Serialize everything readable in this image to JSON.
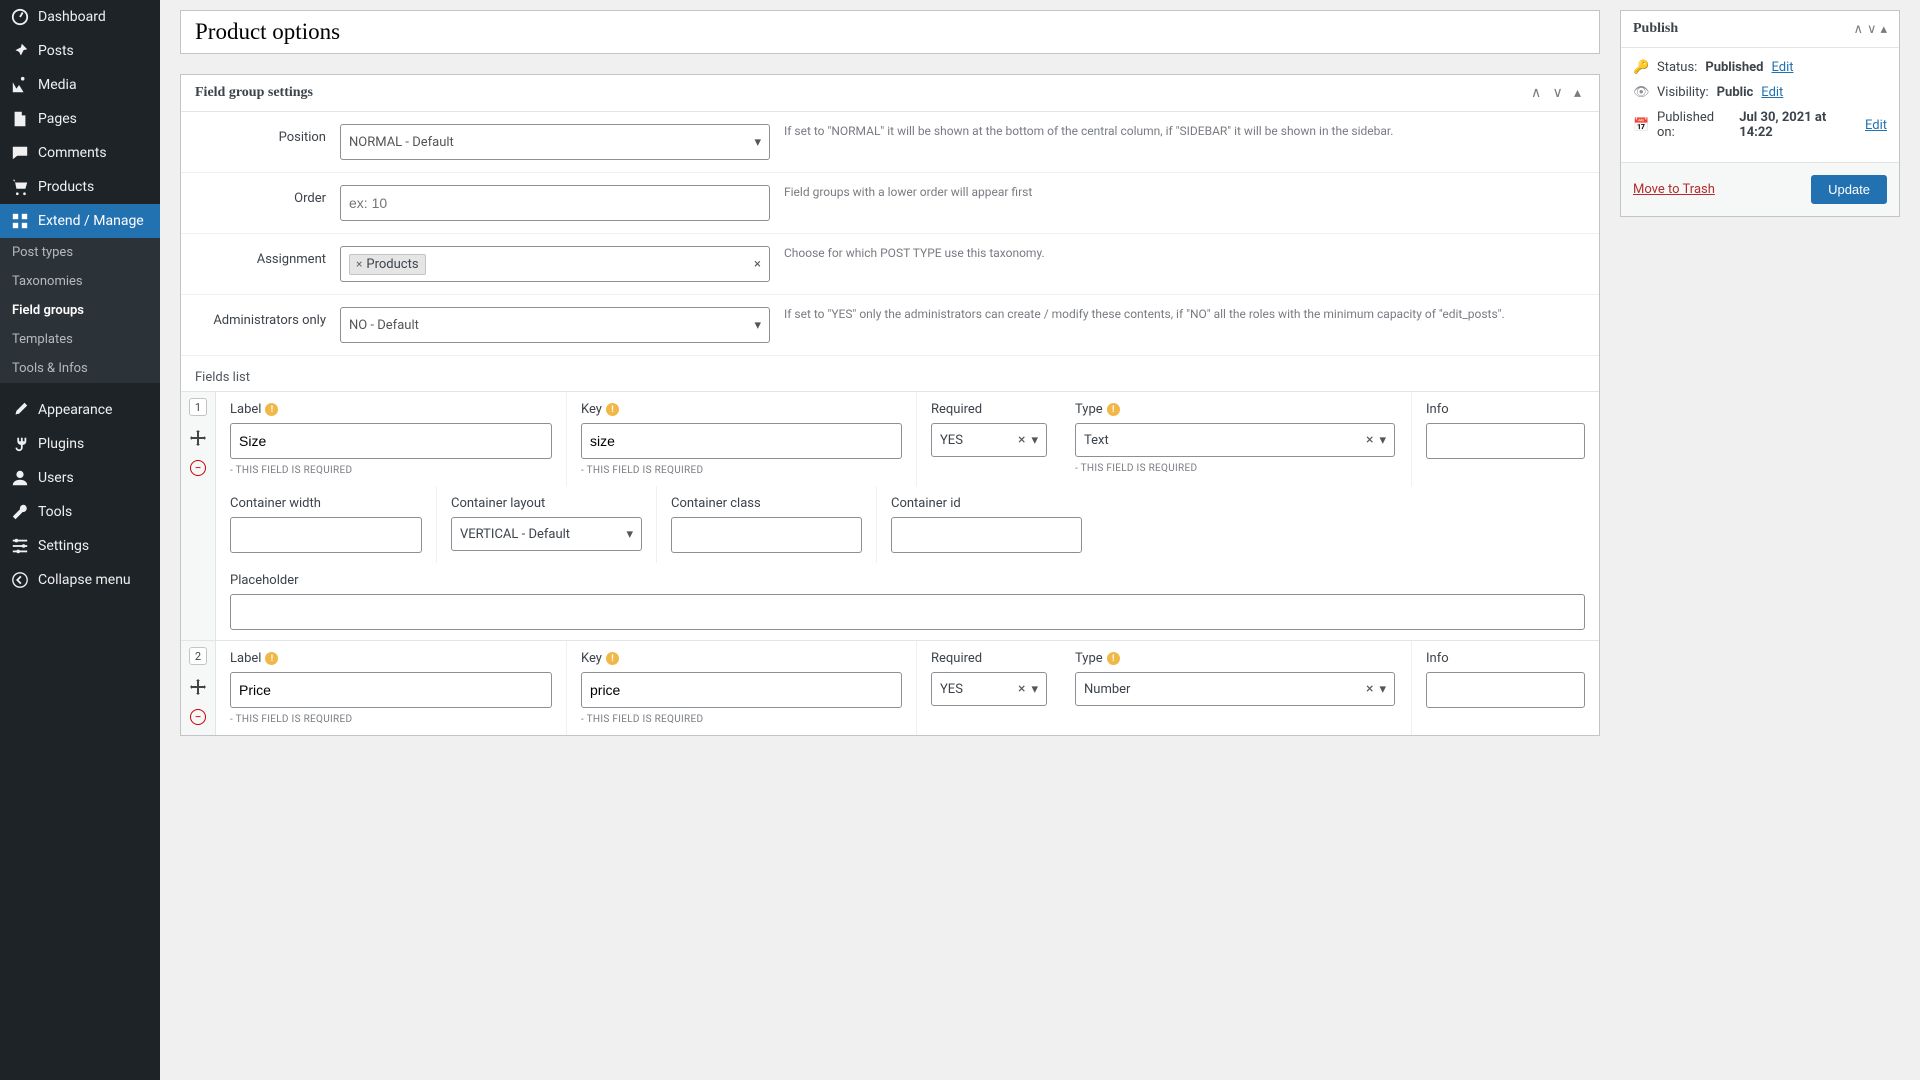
{
  "sidebar": {
    "items": [
      {
        "icon": "dashboard",
        "label": "Dashboard"
      },
      {
        "icon": "pin",
        "label": "Posts"
      },
      {
        "icon": "media",
        "label": "Media"
      },
      {
        "icon": "page",
        "label": "Pages"
      },
      {
        "icon": "comment",
        "label": "Comments"
      },
      {
        "icon": "cart",
        "label": "Products"
      },
      {
        "icon": "extend",
        "label": "Extend / Manage",
        "active": true
      }
    ],
    "sub": [
      {
        "label": "Post types"
      },
      {
        "label": "Taxonomies"
      },
      {
        "label": "Field groups",
        "active": true
      },
      {
        "label": "Templates"
      },
      {
        "label": "Tools & Infos"
      }
    ],
    "items2": [
      {
        "icon": "brush",
        "label": "Appearance"
      },
      {
        "icon": "plug",
        "label": "Plugins"
      },
      {
        "icon": "user",
        "label": "Users"
      },
      {
        "icon": "wrench",
        "label": "Tools"
      },
      {
        "icon": "settings",
        "label": "Settings"
      },
      {
        "icon": "collapse",
        "label": "Collapse menu"
      }
    ]
  },
  "title": "Product options",
  "settings": {
    "header": "Field group settings",
    "position": {
      "label": "Position",
      "value": "NORMAL - Default",
      "help": "If set to \"NORMAL\" it will be shown at the bottom of the central column, if \"SIDEBAR\" it will be shown in the sidebar."
    },
    "order": {
      "label": "Order",
      "placeholder": "ex: 10",
      "help": "Field groups with a lower order will appear first"
    },
    "assignment": {
      "label": "Assignment",
      "tag": "Products",
      "help": "Choose for which POST TYPE use this taxonomy."
    },
    "admins": {
      "label": "Administrators only",
      "value": "NO - Default",
      "help": "If set to \"YES\" only the administrators can create / modify these contents, if \"NO\" all the roles with the minimum capacity of \"edit_posts\"."
    }
  },
  "fields_label": "Fields list",
  "labels": {
    "label": "Label",
    "key": "Key",
    "required": "Required",
    "type": "Type",
    "info": "Info",
    "cwidth": "Container width",
    "clayout": "Container layout",
    "cclass": "Container class",
    "cid": "Container id",
    "placeholder": "Placeholder",
    "reqmsg": "- THIS FIELD IS REQUIRED"
  },
  "fields": [
    {
      "num": "1",
      "label": "Size",
      "key": "size",
      "required": "YES",
      "type": "Text",
      "clayout": "VERTICAL - Default"
    },
    {
      "num": "2",
      "label": "Price",
      "key": "price",
      "required": "YES",
      "type": "Number"
    }
  ],
  "publish": {
    "header": "Publish",
    "status_label": "Status:",
    "status_value": "Published",
    "status_edit": "Edit",
    "vis_label": "Visibility:",
    "vis_value": "Public",
    "vis_edit": "Edit",
    "date_label": "Published on:",
    "date_value": "Jul 30, 2021 at 14:22",
    "date_edit": "Edit",
    "trash": "Move to Trash",
    "update": "Update"
  }
}
